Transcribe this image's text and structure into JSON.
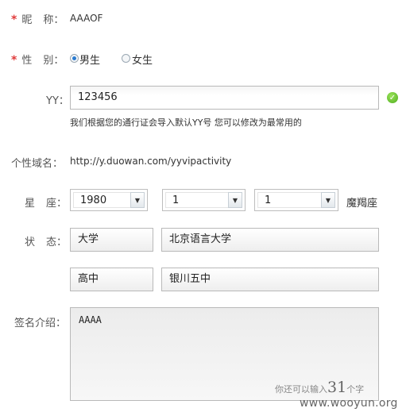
{
  "nickname": {
    "label_a": "昵",
    "label_b": "称：",
    "value": "AAAOF",
    "required_mark": "*"
  },
  "gender": {
    "label_a": "性",
    "label_b": "别：",
    "required_mark": "*",
    "options": [
      {
        "label": "男生",
        "checked": true
      },
      {
        "label": "女生",
        "checked": false
      }
    ]
  },
  "yy": {
    "label": "YY：",
    "value": "123456",
    "hint": "我们根据您的通行证会导入默认YY号 您可以修改为最常用的",
    "status_icon": "check-circle-icon",
    "status_color": "#4fae1f"
  },
  "domain": {
    "label": "个性域名：",
    "value": "http://y.duowan.com/yyvipactivity"
  },
  "birthday": {
    "label_a": "星",
    "label_b": "座：",
    "year": "1980",
    "month": "1",
    "day": "1",
    "sign": "魔羯座"
  },
  "status": {
    "label_a": "状",
    "label_b": "态：",
    "rows": [
      {
        "level": "大学",
        "school": "北京语言大学"
      },
      {
        "level": "高中",
        "school": "银川五中"
      }
    ]
  },
  "signature": {
    "label": "签名介绍：",
    "value": "AAAA",
    "counter_prefix": "你还可以输入",
    "counter_num": "31",
    "counter_suffix": "个字"
  },
  "watermark": "www.wooyun.org"
}
